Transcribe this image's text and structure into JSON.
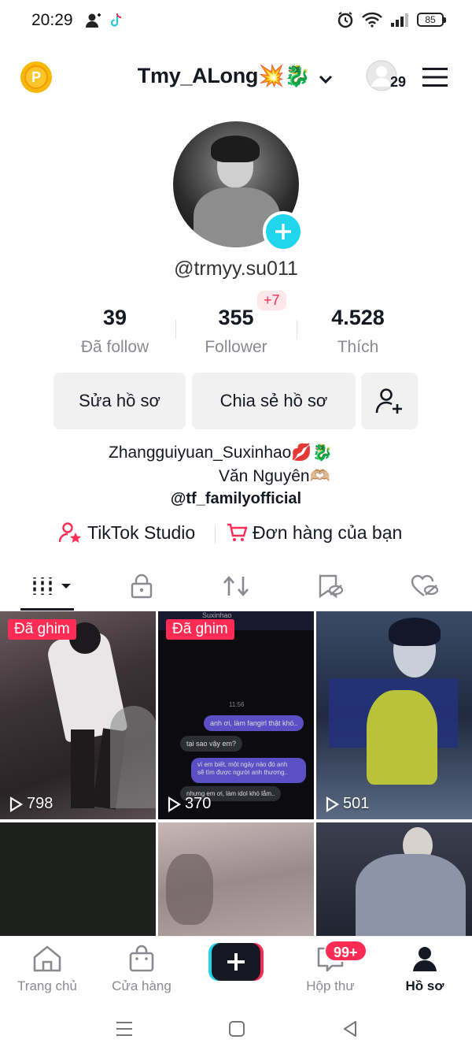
{
  "status_bar": {
    "time": "20:29",
    "battery": "85"
  },
  "header": {
    "username": "Tmy_ALong💥🐉",
    "visitor_count": "29"
  },
  "profile": {
    "handle": "@trmyy.su011",
    "stats": [
      {
        "value": "39",
        "label": "Đã follow"
      },
      {
        "value": "355",
        "label": "Follower"
      },
      {
        "value": "4.528",
        "label": "Thích"
      }
    ],
    "new_followers_badge": "+7",
    "edit_button": "Sửa hồ sơ",
    "share_button": "Chia sẻ hồ sơ",
    "bio_line1": "Zhangguiyuan_Suxinhao💋🐉",
    "bio_line2": "Văn Nguyên🫶🏼",
    "bio_link": "@tf_familyofficial",
    "studio_link": "TikTok Studio",
    "orders_link": "Đơn hàng của bạn"
  },
  "grid": {
    "pinned_label": "Đã ghim",
    "videos": [
      {
        "plays": "798",
        "pinned": true
      },
      {
        "plays": "370",
        "pinned": true
      },
      {
        "plays": "501",
        "pinned": false
      }
    ],
    "chat_preview": {
      "header": "Suxinhao",
      "time": "11:56",
      "msg1": "anh ơi, làm fangirl thật khó..",
      "msg2": "tại sao vậy em?",
      "msg3": "vì em biết, một ngày nào đó anh",
      "msg4": "sẽ tìm được người anh thương..",
      "msg5": "nhưng em ơi, làm idol khó lắm.."
    }
  },
  "bottom_nav": {
    "home": "Trang chủ",
    "shop": "Cửa hàng",
    "inbox": "Hộp thư",
    "inbox_badge": "99+",
    "profile": "Hồ sơ"
  },
  "colors": {
    "accent_red": "#fe2c55",
    "accent_cyan": "#20d5ec",
    "coin": "#f8b808"
  }
}
